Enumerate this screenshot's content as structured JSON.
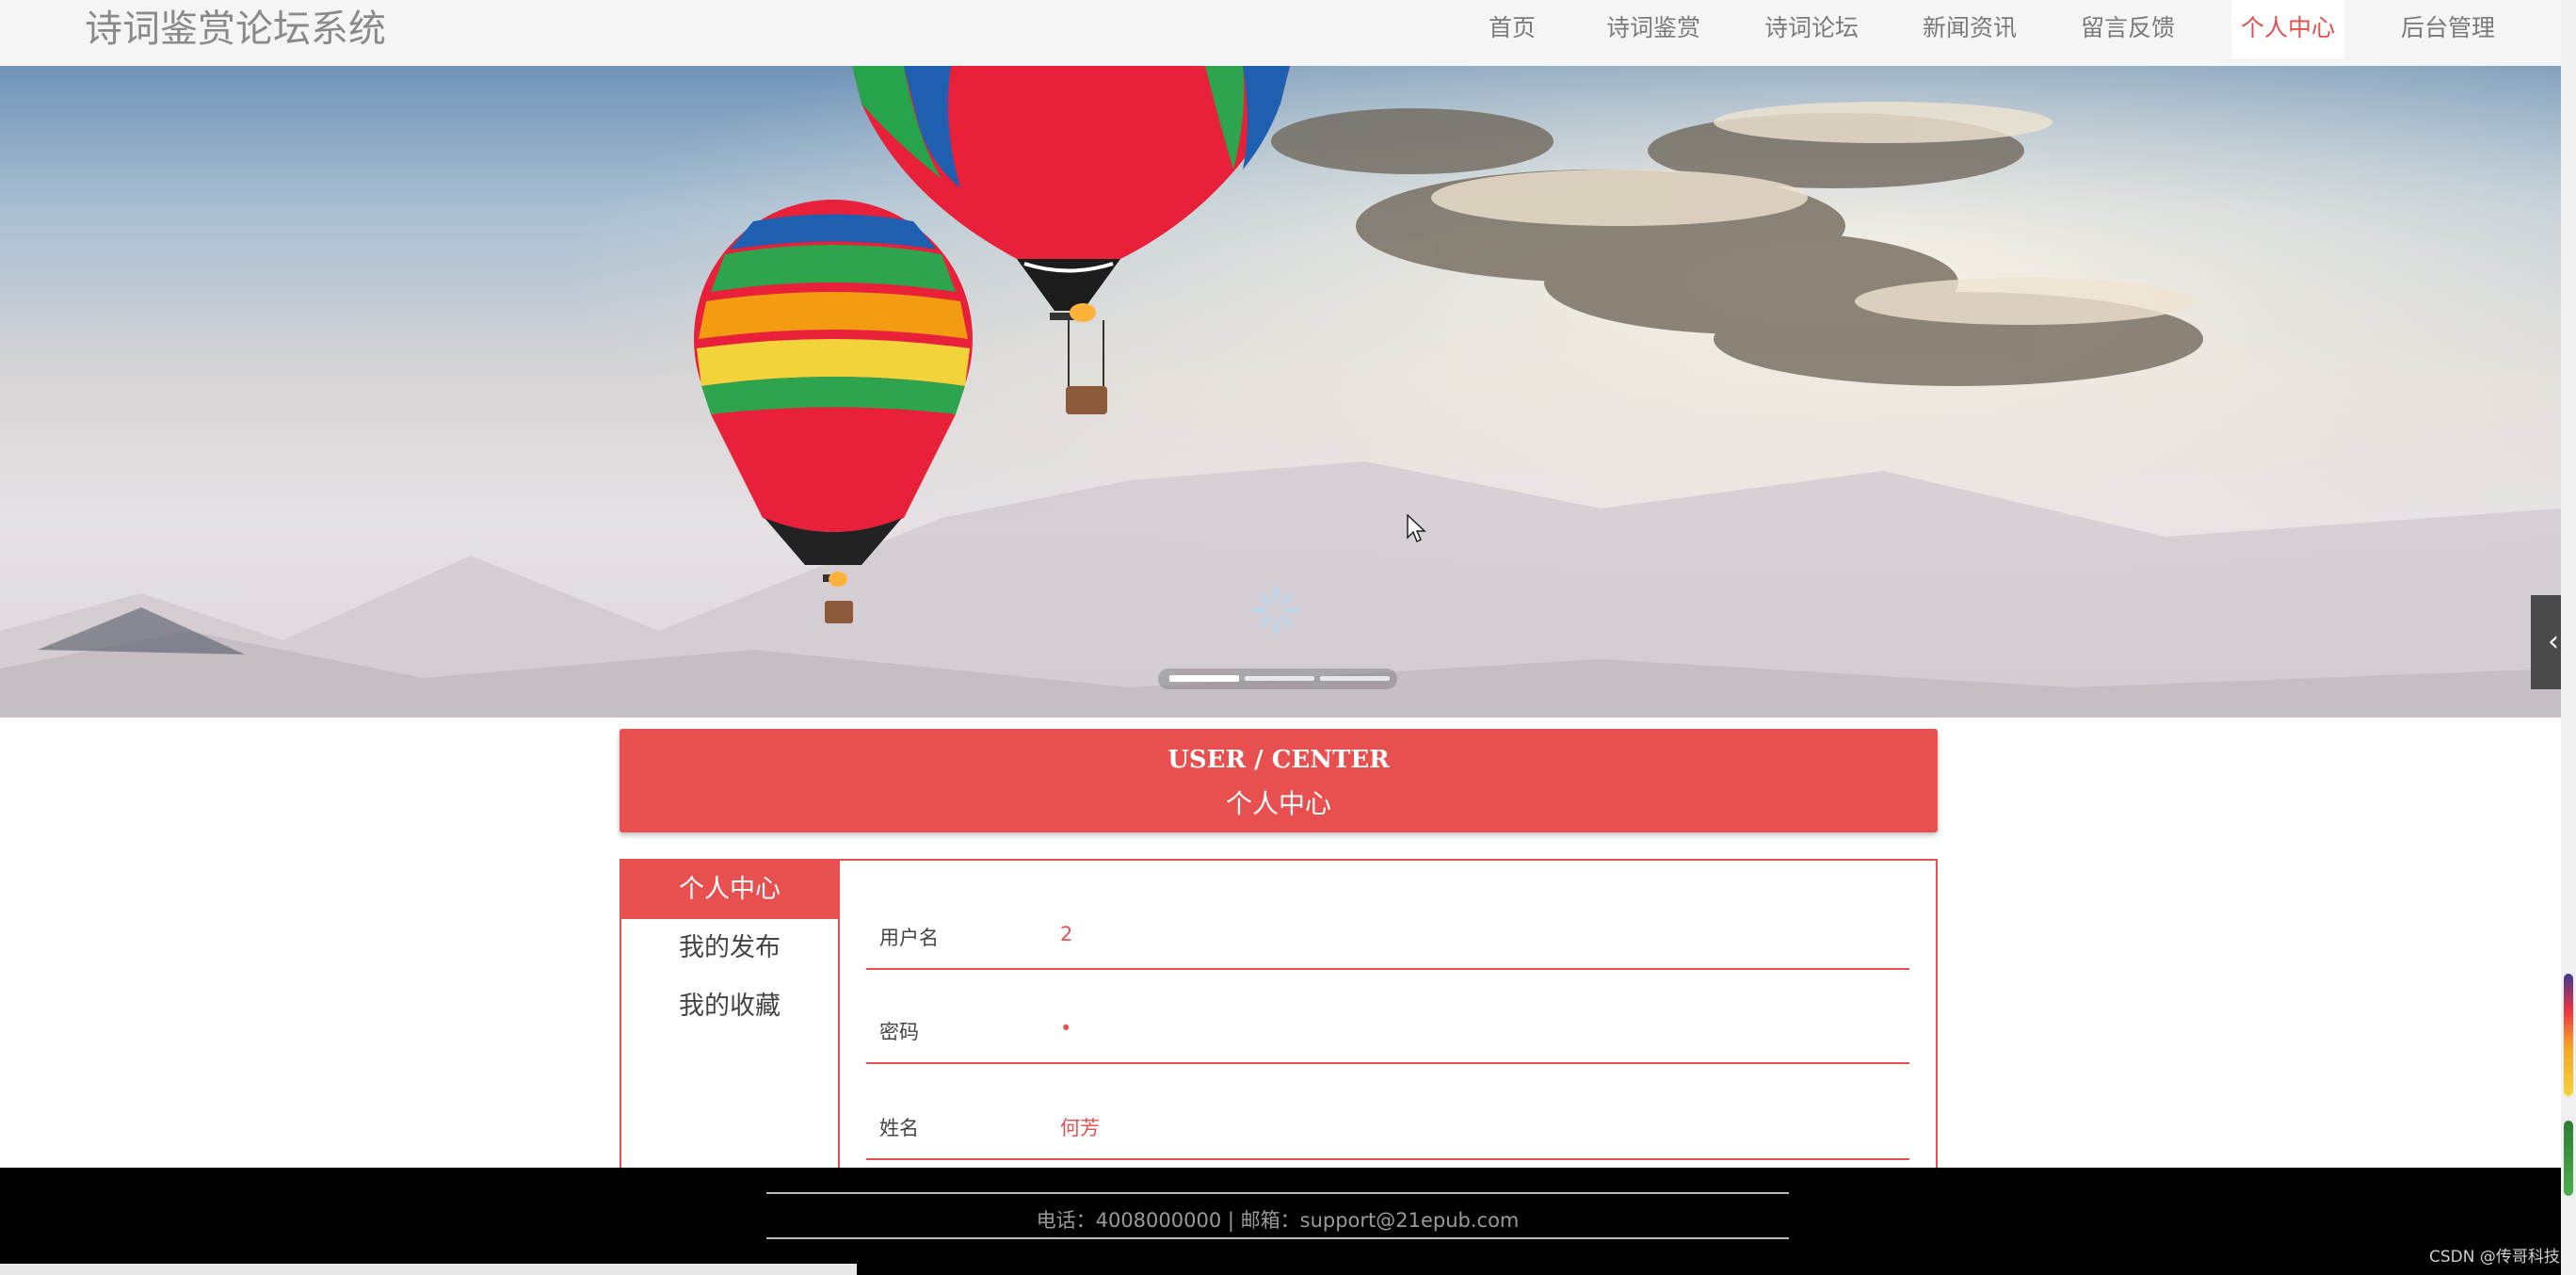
{
  "header": {
    "brand": "诗词鉴赏论坛系统",
    "nav": [
      {
        "label": "首页"
      },
      {
        "label": "诗词鉴赏"
      },
      {
        "label": "诗词论坛"
      },
      {
        "label": "新闻资讯"
      },
      {
        "label": "留言反馈"
      },
      {
        "label": "个人中心",
        "active": true
      },
      {
        "label": "后台管理"
      }
    ]
  },
  "banner": {
    "slide_count": 3,
    "active_slide": 0
  },
  "user_center": {
    "title_en": "USER / CENTER",
    "title_zh": "个人中心",
    "menu": [
      {
        "label": "个人中心",
        "active": true
      },
      {
        "label": "我的发布"
      },
      {
        "label": "我的收藏"
      }
    ],
    "fields": [
      {
        "label": "用户名",
        "value": "2"
      },
      {
        "label": "密码",
        "value": "•"
      },
      {
        "label": "姓名",
        "value": "何芳"
      }
    ]
  },
  "footer": {
    "contact": "电话：4008000000 | 邮箱：support@21epub.com",
    "watermark": "CSDN @传哥科技"
  },
  "colors": {
    "accent": "#e85050",
    "nav_bg": "#f5f5f5",
    "footer_bg": "#000000"
  },
  "side_toggle_icon": "chevron-left-icon"
}
